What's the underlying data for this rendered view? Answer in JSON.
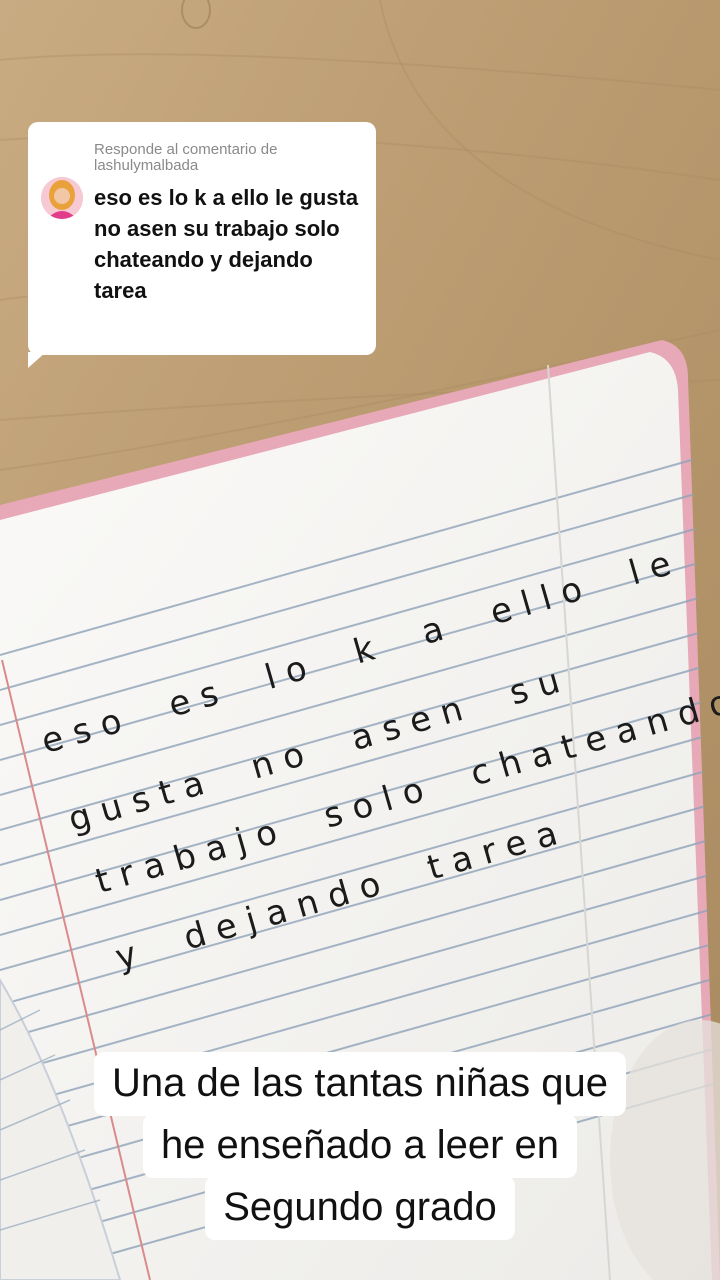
{
  "reply": {
    "header_line1": "Responde al comentario de",
    "header_line2": "lashulymalbada",
    "comment_text": "eso es lo k a ello le gusta no asen su trabajo solo chateando y dejando tarea"
  },
  "handwriting": {
    "line1": "eso es lo k a ello le",
    "line2": "gusta no asen su",
    "line3": "trabajo solo chateando",
    "line4": "y dejando tarea"
  },
  "caption": {
    "line1": "Una de las tantas niñas que",
    "line2": "he enseñado a leer en",
    "line3": "Segundo grado"
  },
  "colors": {
    "table_wood": "#b89a72",
    "notebook_paper": "#f7f5f2",
    "ruled_lines": "#8fa3b8",
    "margin_line": "#d98b8b",
    "notebook_edge": "#e7a9b8"
  }
}
